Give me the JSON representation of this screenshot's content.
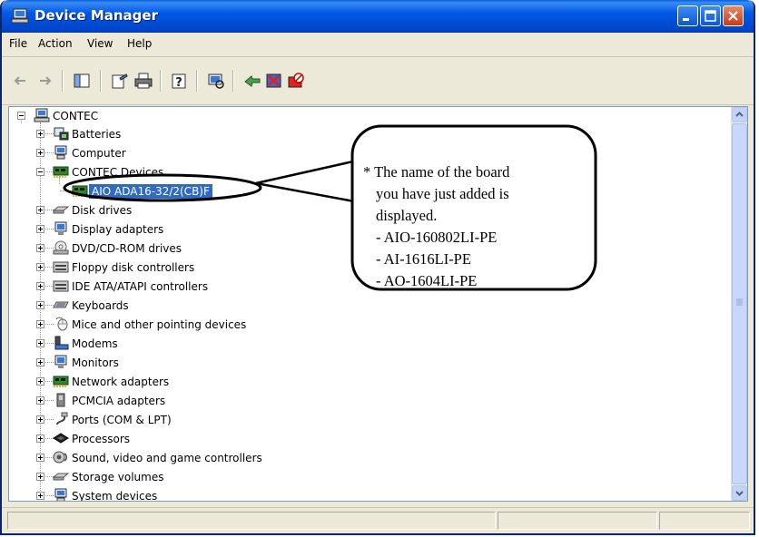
{
  "window": {
    "title": "Device Manager"
  },
  "menu": [
    {
      "label": "File"
    },
    {
      "label": "Action"
    },
    {
      "label": "View"
    },
    {
      "label": "Help"
    }
  ],
  "tree": {
    "root": "CONTEC",
    "items": [
      {
        "label": "Batteries"
      },
      {
        "label": "Computer"
      },
      {
        "label": "CONTEC Devices"
      },
      {
        "label": "AIO ADA16-32/2(CB)F"
      },
      {
        "label": "Disk drives"
      },
      {
        "label": "Display adapters"
      },
      {
        "label": "DVD/CD-ROM drives"
      },
      {
        "label": "Floppy disk controllers"
      },
      {
        "label": "IDE ATA/ATAPI controllers"
      },
      {
        "label": "Keyboards"
      },
      {
        "label": "Mice and other pointing devices"
      },
      {
        "label": "Modems"
      },
      {
        "label": "Monitors"
      },
      {
        "label": "Network adapters"
      },
      {
        "label": "PCMCIA adapters"
      },
      {
        "label": "Ports (COM & LPT)"
      },
      {
        "label": "Processors"
      },
      {
        "label": "Sound, video and game controllers"
      },
      {
        "label": "Storage volumes"
      },
      {
        "label": "System devices"
      }
    ]
  },
  "callout": {
    "lines": [
      "* The name of the board",
      "you have just added is",
      "displayed.",
      "- AIO-160802LI-PE",
      "- AI-1616LI-PE",
      "- AO-1604LI-PE"
    ]
  },
  "colors": {
    "titlebar": "#0058e6",
    "selection": "#316ac5",
    "window_bg": "#ece9d8"
  }
}
